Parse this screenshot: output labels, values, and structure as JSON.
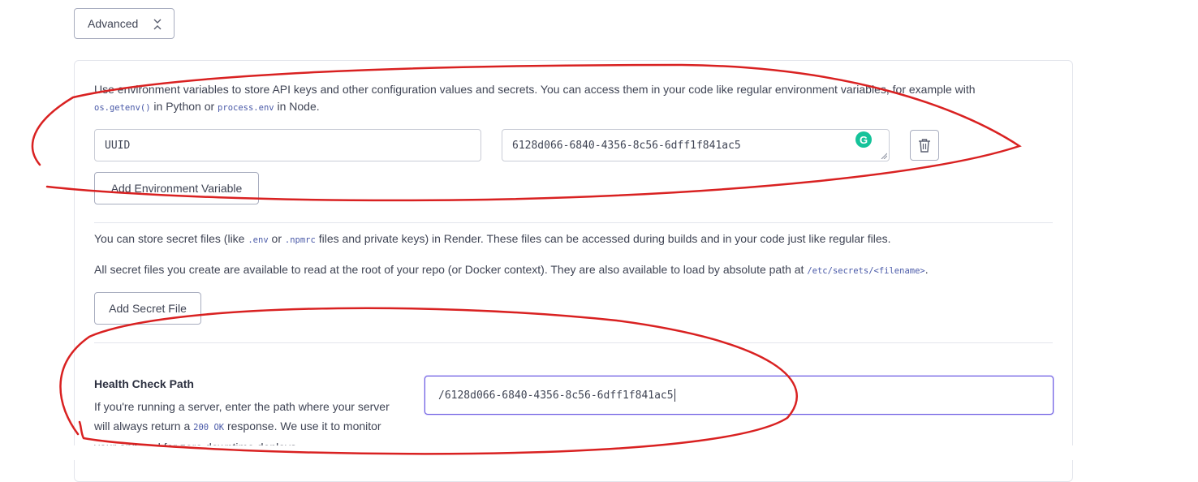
{
  "advanced": {
    "label": "Advanced",
    "icon": "chevron-collapse-icon"
  },
  "env_section": {
    "description_part1": "Use environment variables to store API keys and other configuration values and secrets. You can access them in your code like regular environment variables, for example with",
    "code_getenv": "os.getenv()",
    "text_in_python": " in Python or ",
    "code_process_env": "process.env",
    "text_in_node": " in Node.",
    "variables": [
      {
        "key": "UUID",
        "value": "6128d066-6840-4356-8c56-6dff1f841ac5"
      }
    ],
    "delete_icon": "trash-icon",
    "add_button_label": "Add Environment Variable"
  },
  "secret_files": {
    "line1_part1": "You can store secret files (like ",
    "code_env": ".env",
    "line1_or": " or ",
    "code_npmrc": ".npmrc",
    "line1_part2": " files and private keys) in Render. These files can be accessed during builds and in your code just like regular files.",
    "line2_part1": "All secret files you create are available to read at the root of your repo (or Docker context). They are also available to load by absolute path at ",
    "code_path": "/etc/secrets/<filename>",
    "line2_end": ".",
    "add_button_label": "Add Secret File"
  },
  "health_check": {
    "title": "Health Check Path",
    "desc_part1": "If you're running a server, enter the path where your server will always return a ",
    "code_200": "200 OK",
    "desc_part2": " response. We use it to monitor your app and for zero downtime deploys.",
    "value": "/6128d066-6840-4356-8c56-6dff1f841ac5"
  },
  "extension": {
    "grammarly_letter": "G"
  },
  "colors": {
    "annotation": "#d92121",
    "focus_border": "#6b5be0",
    "code_text": "#4a5aa8",
    "grammarly": "#15c39a"
  }
}
